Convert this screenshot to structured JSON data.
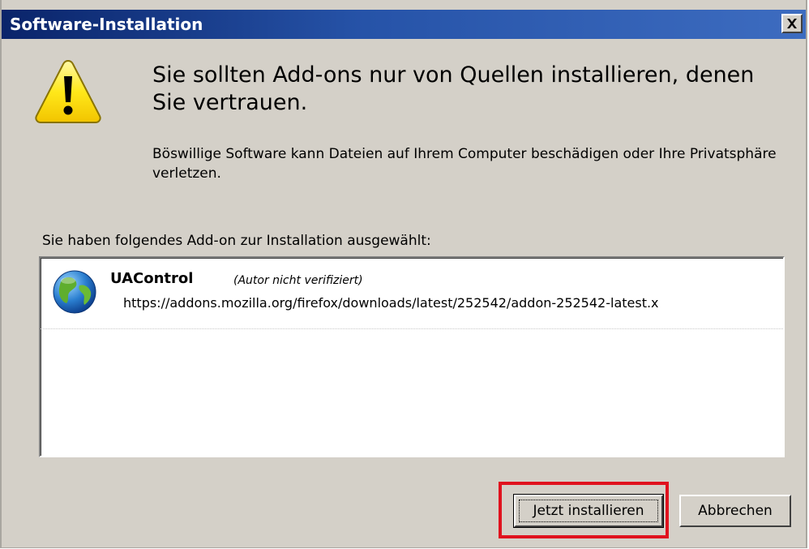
{
  "window": {
    "title": "Software-Installation"
  },
  "warning": {
    "icon": "warning-triangle-icon",
    "heading": "Sie sollten Add-ons nur von Quellen installieren, denen Sie vertrauen.",
    "description": "Böswillige Software kann Dateien auf Ihrem Computer beschädigen oder Ihre Privatsphäre verletzen."
  },
  "selection": {
    "label": "Sie haben folgendes Add-on zur Installation ausgewählt:"
  },
  "addons": [
    {
      "icon": "globe-icon",
      "name": "UAControl",
      "author_note": "(Autor nicht verifiziert)",
      "url": "https://addons.mozilla.org/firefox/downloads/latest/252542/addon-252542-latest.x"
    }
  ],
  "buttons": {
    "install_label": "Jetzt installieren",
    "cancel_label": "Abbrechen"
  },
  "colors": {
    "title_bar": "#0a246a",
    "dialog_bg": "#d4d0c8",
    "highlight": "#e0121e"
  }
}
